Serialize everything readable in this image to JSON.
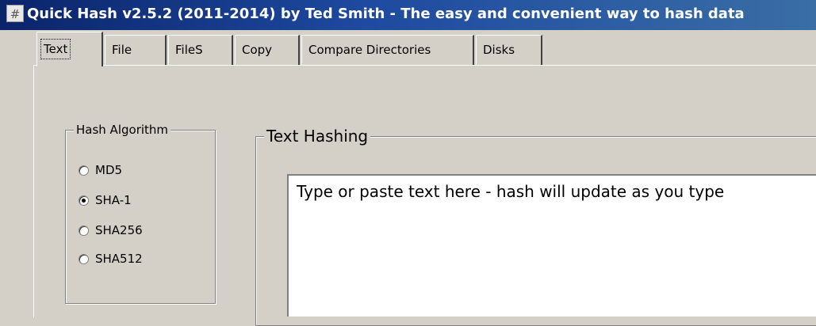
{
  "window": {
    "title": "Quick Hash v2.5.2 (2011-2014) by Ted Smith - The easy and convenient way to hash data",
    "icon": "hash-icon"
  },
  "tabs": [
    {
      "label": "Text",
      "active": true
    },
    {
      "label": "File",
      "active": false
    },
    {
      "label": "FileS",
      "active": false
    },
    {
      "label": "Copy",
      "active": false
    },
    {
      "label": "Compare Directories",
      "active": false
    },
    {
      "label": "Disks",
      "active": false
    }
  ],
  "hash_algorithm": {
    "legend": "Hash Algorithm",
    "options": [
      {
        "label": "MD5",
        "checked": false
      },
      {
        "label": "SHA-1",
        "checked": true
      },
      {
        "label": "SHA256",
        "checked": false
      },
      {
        "label": "SHA512",
        "checked": false
      }
    ]
  },
  "text_hashing": {
    "legend": "Text Hashing",
    "input_text": "Type or paste text here - hash will update as you type"
  }
}
